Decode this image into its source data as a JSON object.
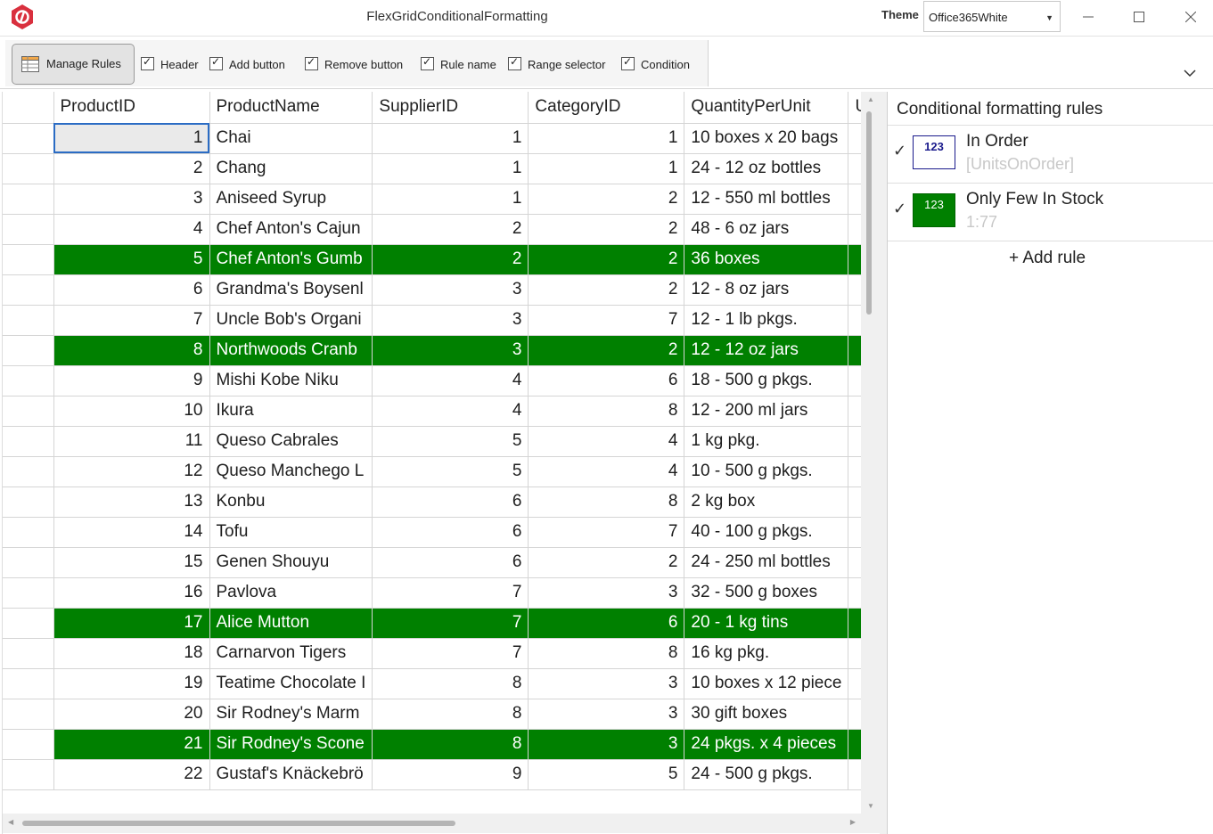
{
  "window": {
    "title": "FlexGridConditionalFormatting",
    "theme_label": "Theme",
    "theme_value": "Office365White",
    "minimize_icon": "minimize-icon",
    "maximize_icon": "maximize-icon",
    "close_icon": "close-icon"
  },
  "ribbon": {
    "manage_rules_label": "Manage Rules",
    "checkboxes": [
      {
        "label": "Header",
        "checked": true
      },
      {
        "label": "Add button",
        "checked": true
      },
      {
        "label": "Remove button",
        "checked": true
      },
      {
        "label": "Rule name",
        "checked": true
      },
      {
        "label": "Range selector",
        "checked": true
      },
      {
        "label": "Condition",
        "checked": true
      }
    ]
  },
  "grid": {
    "columns": [
      "ProductID",
      "ProductName",
      "SupplierID",
      "CategoryID",
      "QuantityPerUnit",
      "Ur"
    ],
    "highlight_color": "#008000",
    "rows": [
      {
        "id": "1",
        "name": "Chai",
        "supplier": "1",
        "category": "1",
        "qty": "10 boxes x 20 bags",
        "hl": false
      },
      {
        "id": "2",
        "name": "Chang",
        "supplier": "1",
        "category": "1",
        "qty": "24 - 12 oz bottles",
        "hl": false
      },
      {
        "id": "3",
        "name": "Aniseed Syrup",
        "supplier": "1",
        "category": "2",
        "qty": "12 - 550 ml bottles",
        "hl": false
      },
      {
        "id": "4",
        "name": "Chef Anton's Cajun",
        "supplier": "2",
        "category": "2",
        "qty": "48 - 6 oz jars",
        "hl": false
      },
      {
        "id": "5",
        "name": "Chef Anton's Gumb",
        "supplier": "2",
        "category": "2",
        "qty": "36 boxes",
        "hl": true
      },
      {
        "id": "6",
        "name": "Grandma's Boysenl",
        "supplier": "3",
        "category": "2",
        "qty": "12 - 8 oz jars",
        "hl": false
      },
      {
        "id": "7",
        "name": "Uncle Bob's Organi",
        "supplier": "3",
        "category": "7",
        "qty": "12 - 1 lb pkgs.",
        "hl": false
      },
      {
        "id": "8",
        "name": "Northwoods Cranb",
        "supplier": "3",
        "category": "2",
        "qty": "12 - 12 oz jars",
        "hl": true
      },
      {
        "id": "9",
        "name": "Mishi Kobe Niku",
        "supplier": "4",
        "category": "6",
        "qty": "18 - 500 g pkgs.",
        "hl": false
      },
      {
        "id": "10",
        "name": "Ikura",
        "supplier": "4",
        "category": "8",
        "qty": "12 - 200 ml jars",
        "hl": false
      },
      {
        "id": "11",
        "name": "Queso Cabrales",
        "supplier": "5",
        "category": "4",
        "qty": "1 kg pkg.",
        "hl": false
      },
      {
        "id": "12",
        "name": "Queso Manchego L",
        "supplier": "5",
        "category": "4",
        "qty": "10 - 500 g pkgs.",
        "hl": false
      },
      {
        "id": "13",
        "name": "Konbu",
        "supplier": "6",
        "category": "8",
        "qty": "2 kg box",
        "hl": false
      },
      {
        "id": "14",
        "name": "Tofu",
        "supplier": "6",
        "category": "7",
        "qty": "40 - 100 g pkgs.",
        "hl": false
      },
      {
        "id": "15",
        "name": "Genen Shouyu",
        "supplier": "6",
        "category": "2",
        "qty": "24 - 250 ml bottles",
        "hl": false
      },
      {
        "id": "16",
        "name": "Pavlova",
        "supplier": "7",
        "category": "3",
        "qty": "32 - 500 g boxes",
        "hl": false
      },
      {
        "id": "17",
        "name": "Alice Mutton",
        "supplier": "7",
        "category": "6",
        "qty": "20 - 1 kg tins",
        "hl": true
      },
      {
        "id": "18",
        "name": "Carnarvon Tigers",
        "supplier": "7",
        "category": "8",
        "qty": "16 kg pkg.",
        "hl": false
      },
      {
        "id": "19",
        "name": "Teatime Chocolate I",
        "supplier": "8",
        "category": "3",
        "qty": "10 boxes x 12 piece",
        "hl": false
      },
      {
        "id": "20",
        "name": "Sir Rodney's Marm",
        "supplier": "8",
        "category": "3",
        "qty": "30 gift boxes",
        "hl": false
      },
      {
        "id": "21",
        "name": "Sir Rodney's Scone",
        "supplier": "8",
        "category": "3",
        "qty": "24 pkgs. x 4 pieces",
        "hl": true
      },
      {
        "id": "22",
        "name": "Gustaf's Knäckebrö",
        "supplier": "9",
        "category": "5",
        "qty": "24 - 500 g pkgs.",
        "hl": false
      }
    ]
  },
  "rules_panel": {
    "title": "Conditional formatting rules",
    "rules": [
      {
        "name": "In Order",
        "expression": "[UnitsOnOrder]",
        "preview": "123",
        "enabled": true
      },
      {
        "name": "Only Few In Stock",
        "expression": "1:77",
        "preview": "123",
        "enabled": true
      }
    ],
    "add_rule_label": "+ Add rule"
  }
}
